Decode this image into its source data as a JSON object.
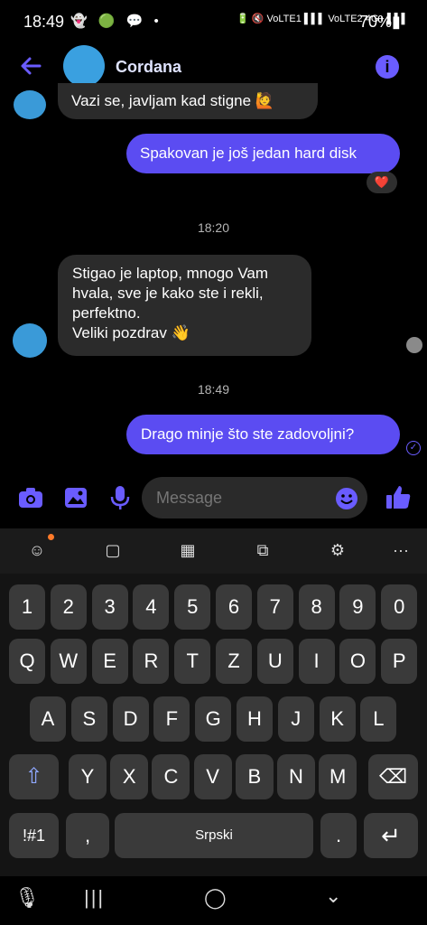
{
  "status_bar": {
    "time": "18:49",
    "left_icons": "👻 🟢 💬 •",
    "right_icons": "🔋 🔇 VoLTE1 ▌▌▌ VoLTE2 4G+ ▌▌▌",
    "battery": "70%▮"
  },
  "header": {
    "contact_name": "Cordana"
  },
  "messages": [
    {
      "dir": "in",
      "text": "Vazi se, javljam kad stigne 🙋"
    },
    {
      "dir": "out",
      "text": "Spakovan je još jedan hard disk",
      "reaction": "❤️"
    },
    {
      "type": "timestamp",
      "text": "18:20"
    },
    {
      "dir": "in",
      "lines": [
        "Stigao je laptop, mnogo Vam",
        "hvala, sve je kako ste i rekli,",
        "perfektno.",
        "Veliki pozdrav 👋"
      ]
    },
    {
      "type": "timestamp",
      "text": "18:49"
    },
    {
      "dir": "out",
      "text": "Drago minje što ste zadovoljni?",
      "status": "✓"
    }
  ],
  "composer": {
    "placeholder": "Message"
  },
  "keyboard": {
    "row_numbers": [
      "1",
      "2",
      "3",
      "4",
      "5",
      "6",
      "7",
      "8",
      "9",
      "0"
    ],
    "row1": [
      "Q",
      "W",
      "E",
      "R",
      "T",
      "Z",
      "U",
      "I",
      "O",
      "P"
    ],
    "row2": [
      "A",
      "S",
      "D",
      "F",
      "G",
      "H",
      "J",
      "K",
      "L"
    ],
    "row3": [
      "Y",
      "X",
      "C",
      "V",
      "B",
      "N",
      "M"
    ],
    "sym_label": "!#1",
    "comma": ",",
    "space_label": "Srpski",
    "period": ".",
    "shift_icon": "⇧",
    "backspace_icon": "⌫",
    "enter_icon": "↵",
    "toolbar": [
      "☺",
      "▢",
      "▦",
      "⧉",
      "⚙",
      "···"
    ]
  },
  "navbar": {
    "mic": "🎙",
    "recents": "|||",
    "home": "◯",
    "back": "⌄"
  },
  "colors": {
    "accent": "#5b4cf2",
    "incoming": "#2b2b2b",
    "keyboard": "#141414",
    "key": "#3a3a3a"
  }
}
